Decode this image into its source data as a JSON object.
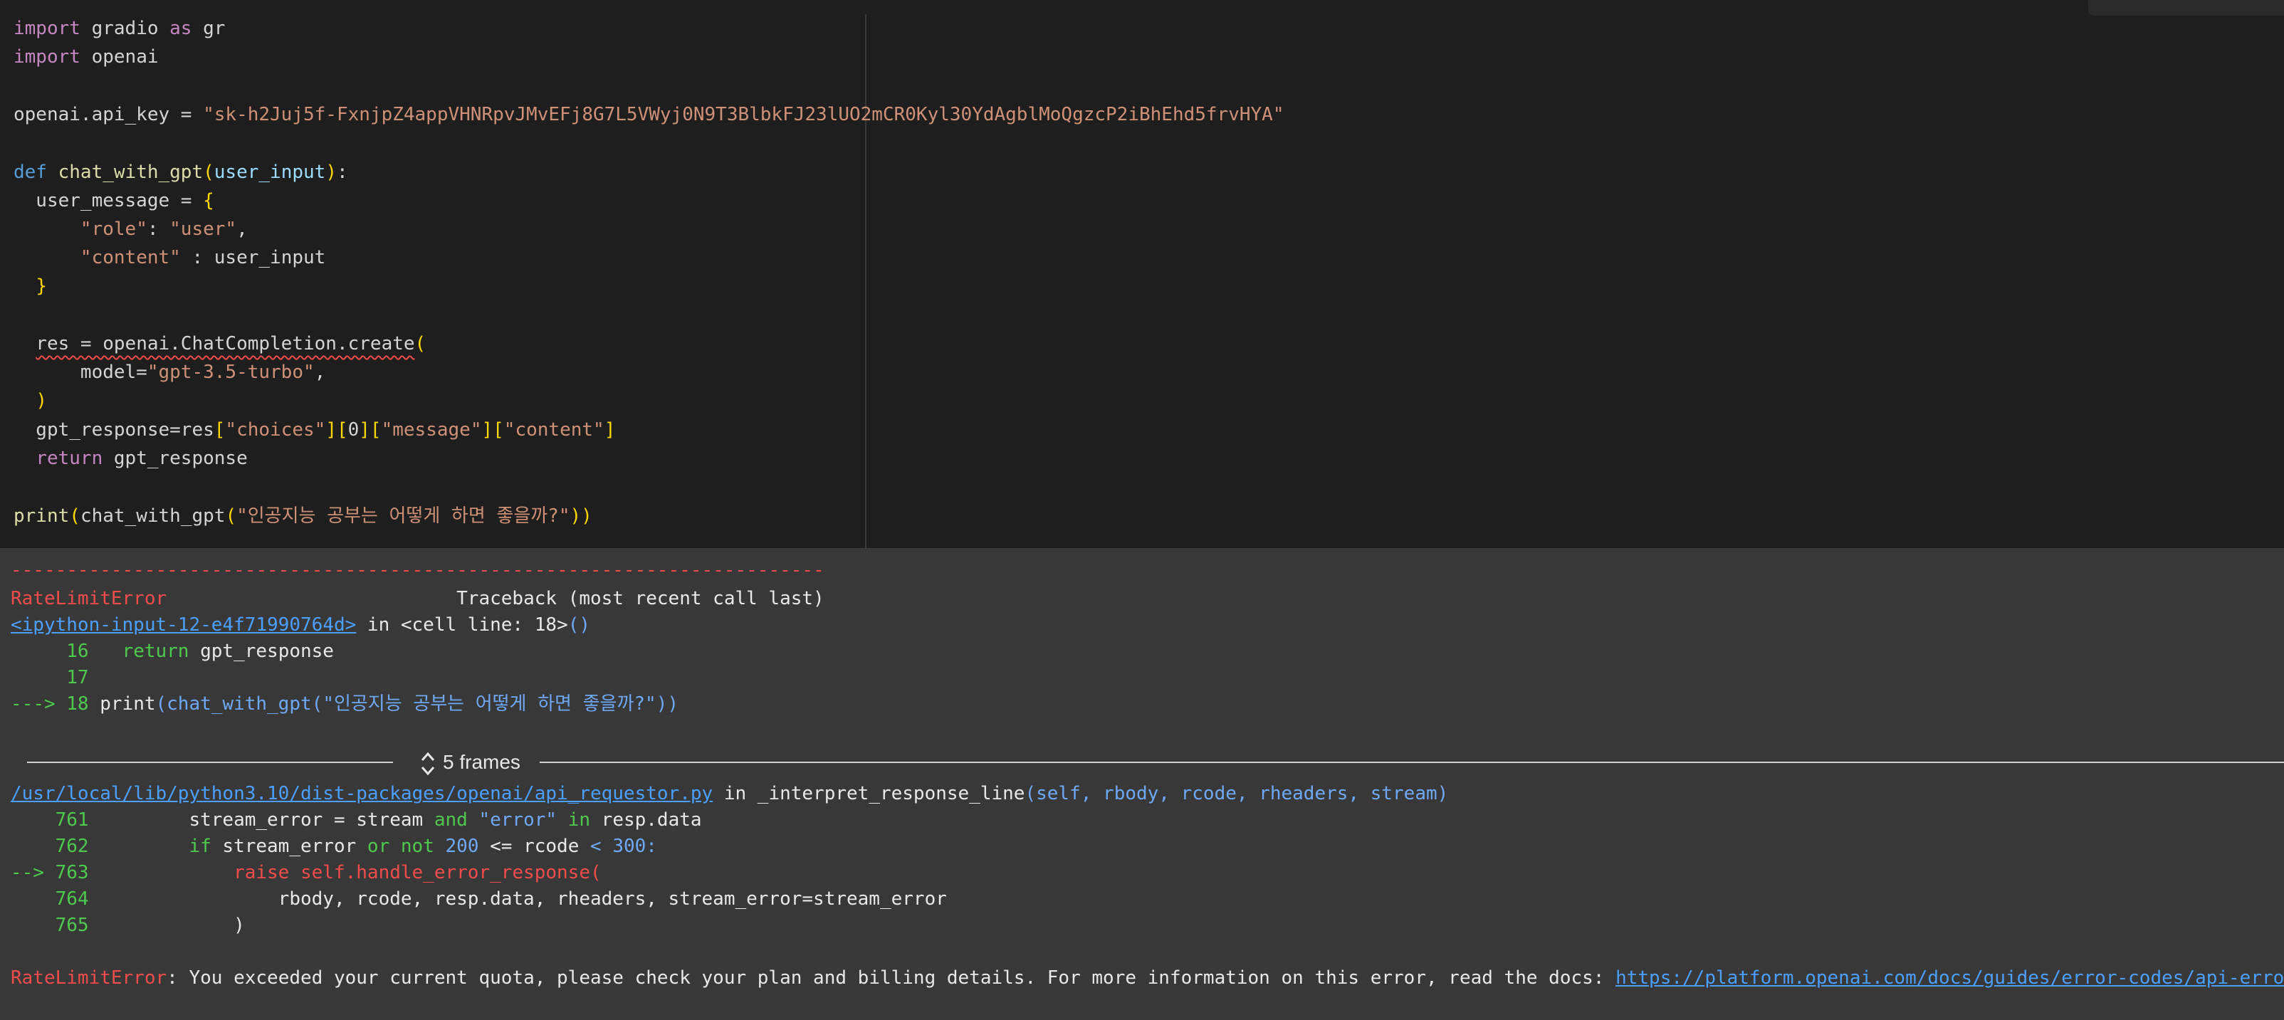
{
  "editor": {
    "lines": {
      "l1": {
        "kw": "import",
        "rest": " gradio ",
        "kw2": "as",
        "rest2": " gr"
      },
      "l2": {
        "kw": "import",
        "rest": " openai"
      },
      "l4": {
        "lhs": "openai.api_key = ",
        "str": "\"sk-h2Juj5f-FxnjpZ4appVHNRpvJMvEFj8G7L5VWyj0N9T3BlbkFJ23lUO2mCR0Kyl30YdAgblMoQgzcP2iBhEhd5frvHYA\""
      },
      "l6": {
        "kw": "def",
        "space": " ",
        "fn": "chat_with_gpt",
        "open": "(",
        "param": "user_input",
        "close": ")",
        "colon": ":"
      },
      "l7": {
        "text": "  user_message = ",
        "brace": "{"
      },
      "l8": {
        "indent": "      ",
        "key": "\"role\"",
        "sep": ": ",
        "val": "\"user\"",
        "end": ","
      },
      "l9": {
        "indent": "      ",
        "key": "\"content\"",
        "sep": " : user_input"
      },
      "l10": {
        "indent": "  ",
        "brace": "}"
      },
      "l12": {
        "indent": "  ",
        "squig": "res = openai.ChatCompletion.create",
        "paren": "("
      },
      "l13": {
        "indent": "      model=",
        "str": "\"gpt-3.5-turbo\"",
        "end": ","
      },
      "l14": {
        "indent": "  ",
        "paren": ")"
      },
      "l15": {
        "pre": "  gpt_response=res",
        "b1": "[",
        "s1": "\"choices\"",
        "b2": "][",
        "n": "0",
        "b3": "][",
        "s2": "\"message\"",
        "b4": "][",
        "s3": "\"content\"",
        "b5": "]"
      },
      "l16": {
        "indent": "  ",
        "kw": "return",
        "rest": " gpt_response"
      },
      "l18": {
        "fn": "print",
        "p1": "(",
        "call": "chat_with_gpt",
        "p2": "(",
        "str": "\"인공지능 공부는 어떻게 하면 좋을까?\"",
        "p3": "))"
      }
    }
  },
  "output": {
    "dashes": "-------------------------------------------------------------------------",
    "error_name": "RateLimitError",
    "traceback_header": "                          Traceback (most recent call last)",
    "cell_link": "<ipython-input-12-e4f71990764d>",
    "cell_rest_a": " in <cell line: 18>",
    "cell_rest_b": "()",
    "t16_num": "     16",
    "t16_kw": "   return",
    "t16_rest": " gpt_response",
    "t17_num": "     17",
    "t18_arrow": "---> 18",
    "t18_code_a": " print",
    "t18_code_b": "(chat_with_gpt(",
    "t18_str": "\"인공지능 공부는 어떻게 하면 좋을까?\"",
    "t18_code_c": "))",
    "frames_label": "5 frames",
    "file_link": "/usr/local/lib/python3.10/dist-packages/openai/api_requestor.py",
    "file_rest_a": " in _interpret_response_line",
    "file_rest_b": "(self, rbody, rcode, rheaders, stream)",
    "f761_num": "    761",
    "f761_code_a": "         stream_error = stream ",
    "f761_and": "and",
    "f761_str": " \"error\"",
    "f761_in": " in",
    "f761_code_b": " resp.data",
    "f762_num": "    762",
    "f762_if": "         if",
    "f762_a": " stream_error ",
    "f762_or": "or not",
    "f762_b": " 200",
    "f762_c": " <= rcode ",
    "f762_d": "< 300:",
    "f763_arrow": "--> 763",
    "f763_code": "             raise self.handle_error_response(",
    "f764_num": "    764",
    "f764_code": "                 rbody, rcode, resp.data, rheaders, stream_error=stream_error",
    "f765_num": "    765",
    "f765_code": "             )",
    "final_err": "RateLimitError",
    "final_msg": ": You exceeded your current quota, please check your plan and billing details. For more information on this error, read the docs: ",
    "final_link": "https://platform.openai.com/docs/guides/error-codes/api-errors",
    "final_dot": "."
  },
  "colors": {
    "editor_bg": "#1e1e1e",
    "output_bg": "#383838",
    "error_red": "#f14c4c",
    "link_blue": "#4a9fff"
  },
  "icons": {
    "frames_toggle": "unfold-chevrons-icon"
  }
}
